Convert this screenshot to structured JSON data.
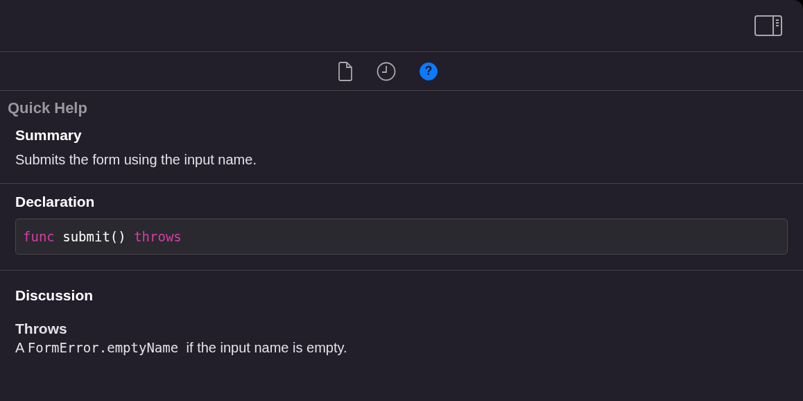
{
  "tabs": [
    {
      "kind": "file",
      "selected": false
    },
    {
      "kind": "history",
      "selected": false
    },
    {
      "kind": "help",
      "selected": true,
      "label": "?"
    }
  ],
  "title": "Quick Help",
  "summary": {
    "heading": "Summary",
    "text": "Submits the form using the input name."
  },
  "declaration": {
    "heading": "Declaration",
    "tokens": [
      {
        "kind": "keyword",
        "text": "func"
      },
      {
        "kind": "plain",
        "text": "submit()"
      },
      {
        "kind": "keyword",
        "text": "throws"
      }
    ]
  },
  "discussion": {
    "heading": "Discussion"
  },
  "throws": {
    "heading": "Throws",
    "parts": [
      {
        "kind": "text",
        "text": "A"
      },
      {
        "kind": "code",
        "text": "FormError.emptyName"
      },
      {
        "kind": "text",
        "text": "if the input name is empty."
      }
    ]
  }
}
